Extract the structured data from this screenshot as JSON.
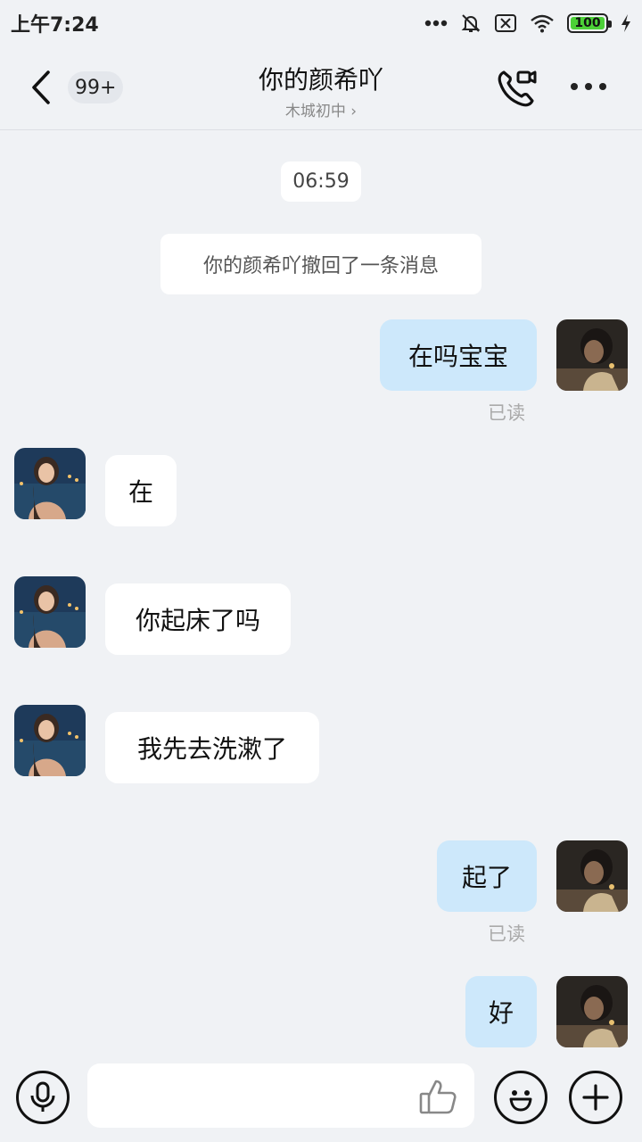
{
  "status_bar": {
    "time": "上午7:24",
    "battery_level": "100",
    "icons": [
      "more-dots-icon",
      "mute-bell-icon",
      "sim-off-icon",
      "wifi-icon",
      "battery-icon",
      "charging-icon"
    ]
  },
  "header": {
    "unread_count": "99+",
    "title": "你的颜希吖",
    "subtitle": "木城初中 ›"
  },
  "chat": {
    "timestamp": "06:59",
    "system_message": "你的颜希吖撤回了一条消息",
    "messages": [
      {
        "direction": "out",
        "text": "在吗宝宝",
        "status": "已读"
      },
      {
        "direction": "in",
        "text": "在"
      },
      {
        "direction": "in",
        "text": "你起床了吗"
      },
      {
        "direction": "in",
        "text": "我先去洗漱了"
      },
      {
        "direction": "out",
        "text": "起了",
        "status": "已读"
      },
      {
        "direction": "out",
        "text": "好"
      }
    ]
  },
  "input_bar": {
    "placeholder": ""
  },
  "colors": {
    "background": "#f0f2f5",
    "outgoing_bubble": "#cde8fb",
    "incoming_bubble": "#ffffff",
    "battery_green": "#4cd137"
  }
}
